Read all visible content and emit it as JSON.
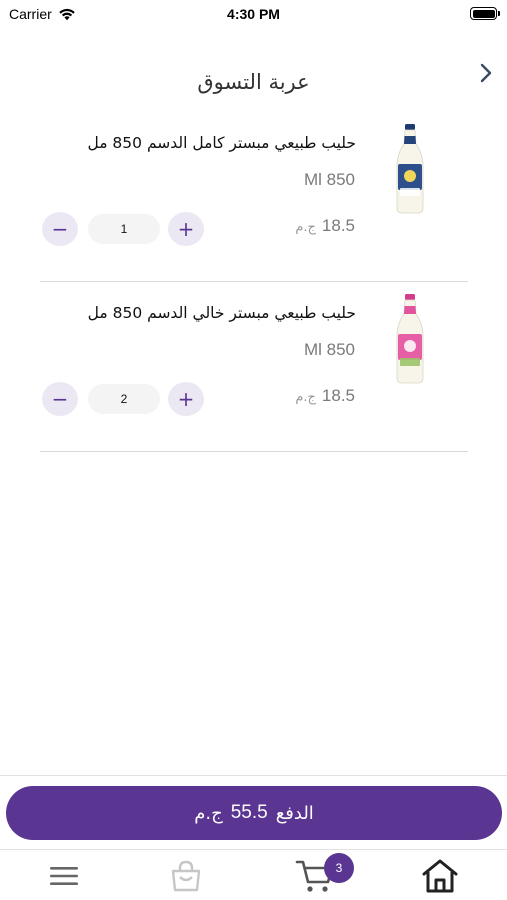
{
  "status_bar": {
    "carrier": "Carrier",
    "time": "4:30 PM"
  },
  "header": {
    "title": "عربة التسوق"
  },
  "cart": {
    "items": [
      {
        "name": "حليب طبيعي مبستر كامل الدسم 850 مل",
        "size": "Ml 850",
        "price": "18.5",
        "currency": "ج.م",
        "quantity": "1",
        "image_icon": "milk-bottle-full-cream"
      },
      {
        "name": "حليب طبيعي مبستر خالي الدسم 850 مل",
        "size": "Ml 850",
        "price": "18.5",
        "currency": "ج.م",
        "quantity": "2",
        "image_icon": "milk-bottle-skimmed"
      }
    ],
    "minus_symbol": "−",
    "plus_symbol": "+"
  },
  "checkout": {
    "label": "الدفع",
    "amount": "55.5",
    "currency": "ج.م"
  },
  "tab_bar": {
    "cart_badge_count": "3",
    "icons": [
      "menu-icon",
      "bag-icon",
      "cart-icon",
      "home-icon"
    ]
  },
  "colors": {
    "accent": "#5b3592",
    "button_bg": "#ece8f3",
    "divider": "#d9d9d9"
  }
}
